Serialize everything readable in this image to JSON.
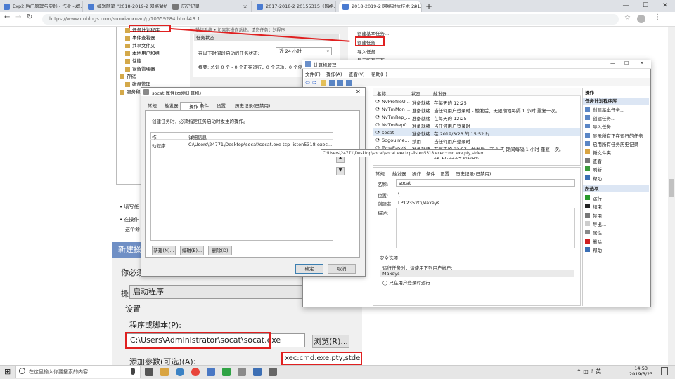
{
  "browser": {
    "tabs": [
      {
        "label": "Exp2 后门原理与实践 - 作业 - 博..."
      },
      {
        "label": "编辑随笔 \"2018-2019-2 网络对抗..."
      },
      {
        "label": "历史记录"
      },
      {
        "label": "2017-2018-2 20155315《网络..."
      },
      {
        "label": "2018-2019-2 网络对抗技术 201..."
      }
    ],
    "new_tab": "+",
    "url": "https://www.cnblogs.com/sunxiaoxuan/p/10559284.html#3.1",
    "window_controls": {
      "minimize": "—",
      "maximize": "☐",
      "close": "✕"
    },
    "star": "☆"
  },
  "background_panel": {
    "tree": [
      {
        "label": "任务计划程序"
      },
      {
        "label": "事件查看器"
      },
      {
        "label": "共享文件夹"
      },
      {
        "label": "本地用户和组"
      },
      {
        "label": "性能"
      },
      {
        "label": "设备管理器"
      },
      {
        "label": "存储"
      },
      {
        "label": "磁盘管理"
      },
      {
        "label": "服务和应用程序"
      }
    ],
    "top_cut": "操作系统 • 如果其操作系统，请您任务计划程序",
    "task_status": "任务状态",
    "status_question": "在以下时间段启动的任务状态:",
    "status_period": "近 24 小时",
    "summary": "摘要: 总计 0 个 - 0 个正在运行，0 个成功，0 个停...",
    "right_actions": [
      "创建基本任务...",
      "创建任务...",
      "导入任务...",
      "显示所有正在..."
    ]
  },
  "blog": {
    "bullet1": "填写任",
    "bullet2": "在操作",
    "bullet2b": "这个命",
    "new_op_title": "新建操作",
    "need_to": "你必须",
    "op_label": "操作(I):",
    "op_value": "启动程序",
    "settings": "设置",
    "program_label": "程序或脚本(P):",
    "program_value": "C:\\Users\\Administrator\\socat\\socat.exe",
    "browse": "浏览(R)...",
    "args_label": "添加参数(可选)(A):",
    "args_value": "xec:cmd.exe,pty,stderr"
  },
  "socat_dialog": {
    "title": "socat 属性(本地计算机)",
    "tabs": [
      "常规",
      "触发器",
      "操作",
      "条件",
      "设置",
      "历史记录(已禁用)"
    ],
    "desc": "创建任务时，必须指定任务启动时发生的操作。",
    "col1": "作",
    "col2": "详细信息",
    "row_action": "动程序",
    "row_detail": "C:\\Users\\24771\\Desktop\\socat\\socat.exe tcp-listen5318 exec...",
    "tooltip": "C:\\Users\\24771\\Desktop\\socat\\socat.exe tcp-listen5318 exec:cmd.exe,pty,stderr",
    "new_btn": "新建(N)...",
    "edit_btn": "编辑(E)...",
    "delete_btn": "删除(D)",
    "ok_btn": "确定",
    "cancel_btn": "取消",
    "close": "✕"
  },
  "computer_mgmt": {
    "title": "计算机管理",
    "menu": [
      "文件(F)",
      "操作(A)",
      "查看(V)",
      "帮助(H)"
    ],
    "columns": [
      "名称",
      "状态",
      "触发器"
    ],
    "tasks": [
      {
        "name": "NvProfileU...",
        "status": "准备就绪",
        "trigger": "在每天的 12:25"
      },
      {
        "name": "NvTmMon_...",
        "status": "准备就绪",
        "trigger": "当任何用户登录时 - 触发后，无限期地每隔 1 小时 重复一次。"
      },
      {
        "name": "NvTmRep_...",
        "status": "准备就绪",
        "trigger": "在每天的 12:25"
      },
      {
        "name": "NvTmRep0...",
        "status": "准备就绪",
        "trigger": "当任何用户登录时"
      },
      {
        "name": "socat",
        "status": "准备就绪",
        "trigger": "在 2019/3/23 的 15:52 时"
      },
      {
        "name": "Sogoulme...",
        "status": "禁用",
        "trigger": "当任何用户登录时"
      },
      {
        "name": "TypeEasyN...",
        "status": "准备就绪",
        "trigger": "在每天的 22:57 - 触发后，在 1 天 期间每隔 1 小时 重复一次。"
      },
      {
        "name": "",
        "status": "",
        "trigger": "22 17:05:04 时过期。"
      }
    ],
    "detail_tabs": [
      "常规",
      "触发器",
      "操作",
      "条件",
      "设置",
      "历史记录(已禁用)"
    ],
    "name_label": "名称:",
    "name_value": "socat",
    "location_label": "位置:",
    "location_value": "\\",
    "author_label": "创建者:",
    "author_value": "LP123520\\Maxeys",
    "desc_label": "描述:",
    "security": "安全选项",
    "run_as_label": "运行任务时，请使用下列用户帐户:",
    "run_as_value": "Maxeys",
    "only_logged": "只在用户登录时运行",
    "actions_header": "操作",
    "actions_section": "任务计划程序库",
    "actions": [
      "创建基本任务...",
      "创建任务...",
      "导入任务...",
      "显示所有正在运行的任务",
      "启用所有任务历史记录",
      "新文件夹...",
      "查看",
      "刷新",
      "帮助"
    ],
    "selected_header": "所选项",
    "selected_actions": [
      "运行",
      "结束",
      "禁用",
      "导出...",
      "属性",
      "删除",
      "帮助"
    ]
  },
  "taskbar": {
    "search_placeholder": "在这里输入你要搜索的内容",
    "time": "14:53",
    "date": "2019/3/23"
  },
  "colors": {
    "highlight_red": "#e02020",
    "header_blue": "#6f8fc5",
    "accent_blue": "#1a73e8"
  }
}
